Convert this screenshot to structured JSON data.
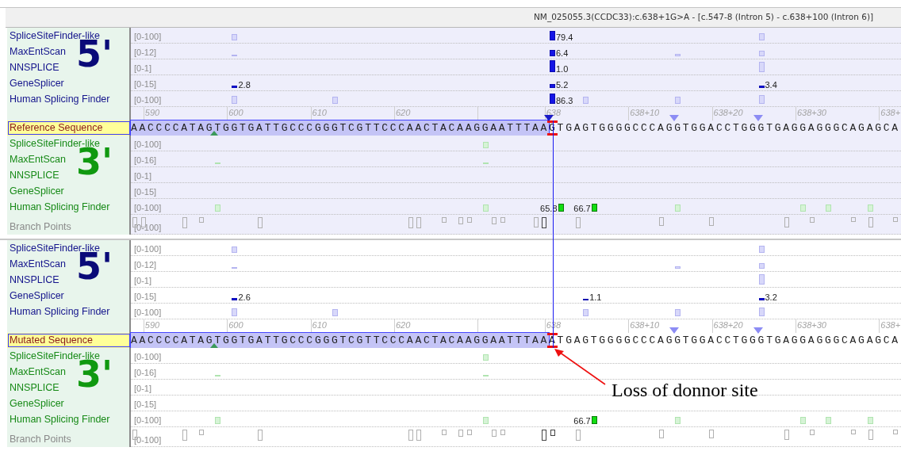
{
  "header": {
    "title": "NM_025055.3(CCDC33):c.638+1G>A - [c.547-8 (Intron 5) - c.638+100 (Intron 6)]"
  },
  "blocks": [
    {
      "kind": "donor_tracks",
      "site": "5'",
      "shaded": true,
      "tracks": [
        {
          "kind": "score",
          "name": "SpliceSiteFinder-like",
          "range": "[0-100]",
          "bars": [
            {
              "highlighted": false
            },
            {
              "highlighted": true,
              "value": "79.4"
            },
            {
              "highlighted": false
            }
          ]
        },
        {
          "kind": "score",
          "name": "MaxEntScan",
          "range": "[0-12]",
          "bars": [
            {
              "highlighted": false
            },
            {
              "highlighted": true,
              "value": "6.4"
            },
            {
              "highlighted": false
            },
            {
              "highlighted": false
            }
          ]
        },
        {
          "kind": "score",
          "name": "NNSPLICE",
          "range": "[0-1]",
          "bars": [
            {
              "highlighted": true,
              "value": "1.0"
            },
            {
              "highlighted": false
            }
          ]
        },
        {
          "kind": "score",
          "name": "GeneSplicer",
          "range": "[0-15]",
          "bars": [
            {
              "highlighted": true,
              "value": "2.8"
            },
            {
              "highlighted": true,
              "value": "5.2"
            },
            {
              "highlighted": true,
              "value": "3.4"
            }
          ]
        },
        {
          "kind": "score",
          "name": "Human Splicing Finder",
          "range": "[0-100]",
          "bars": [
            {
              "highlighted": false
            },
            {
              "highlighted": false
            },
            {
              "highlighted": true,
              "value": "86.3"
            },
            {
              "highlighted": false
            },
            {
              "highlighted": false
            },
            {
              "highlighted": false
            }
          ]
        }
      ]
    },
    {
      "kind": "sequence",
      "shaded": true,
      "ruler": [
        "590",
        "600",
        "610",
        "620",
        "638",
        "638+10",
        "638+20",
        "638+30",
        "638+"
      ],
      "ruler_markers": [
        {
          "kind": "strong"
        },
        {
          "kind": "weak"
        },
        {
          "kind": "weak"
        }
      ],
      "label": "Reference Sequence",
      "exon": "AACCCCATAGTGGTGATTGCCCGGGTCGTTCCCAACTACAAGGAATTTAA",
      "intron": "GTGAGTGGGGCCCAGGTGGACCTGGGTGAGGAGGGCAGAGCA",
      "markers": [
        {
          "kind": "acceptor"
        },
        {
          "kind": "variant"
        }
      ]
    },
    {
      "kind": "acceptor_tracks",
      "site": "3'",
      "shaded": true,
      "tracks": [
        {
          "kind": "score",
          "name": "SpliceSiteFinder-like",
          "range": "[0-100]",
          "bars": [
            {
              "highlighted": false
            }
          ]
        },
        {
          "kind": "score",
          "name": "MaxEntScan",
          "range": "[0-16]",
          "bars": [
            {
              "highlighted": false
            },
            {
              "highlighted": false
            }
          ]
        },
        {
          "kind": "score",
          "name": "NNSPLICE",
          "range": "[0-1]"
        },
        {
          "kind": "score",
          "name": "GeneSplicer",
          "range": "[0-15]"
        },
        {
          "kind": "score",
          "name": "Human Splicing Finder",
          "range": "[0-100]",
          "bars": [
            {
              "highlighted": false
            },
            {
              "highlighted": false
            },
            {
              "highlighted": true,
              "value": "65.8"
            },
            {
              "highlighted": true,
              "value": "66.7"
            },
            {
              "highlighted": false
            },
            {
              "highlighted": false
            },
            {
              "highlighted": false
            },
            {
              "highlighted": false
            }
          ]
        },
        {
          "kind": "branch",
          "name": "Branch Points",
          "range": "[0-100]",
          "points": [
            {
              "highlighted": false
            },
            {
              "highlighted": false
            },
            {
              "highlighted": false
            },
            {
              "highlighted": false
            },
            {
              "highlighted": false
            },
            {
              "highlighted": false
            },
            {
              "highlighted": false
            },
            {
              "highlighted": false
            },
            {
              "highlighted": false
            },
            {
              "highlighted": false
            },
            {
              "highlighted": false
            },
            {
              "highlighted": false
            },
            {
              "highlighted": false
            },
            {
              "highlighted": true
            },
            {
              "highlighted": false
            },
            {
              "highlighted": false
            },
            {
              "highlighted": false
            },
            {
              "highlighted": false
            },
            {
              "highlighted": false
            },
            {
              "highlighted": false
            },
            {
              "highlighted": false
            },
            {
              "highlighted": false
            }
          ]
        }
      ]
    },
    {
      "kind": "donor_tracks",
      "site": "5'",
      "shaded": false,
      "tracks": [
        {
          "kind": "score",
          "name": "SpliceSiteFinder-like",
          "range": "[0-100]",
          "bars": [
            {
              "highlighted": false
            },
            {
              "highlighted": false
            }
          ]
        },
        {
          "kind": "score",
          "name": "MaxEntScan",
          "range": "[0-12]",
          "bars": [
            {
              "highlighted": false
            },
            {
              "highlighted": false
            },
            {
              "highlighted": false
            }
          ]
        },
        {
          "kind": "score",
          "name": "NNSPLICE",
          "range": "[0-1]",
          "bars": [
            {
              "highlighted": false
            }
          ]
        },
        {
          "kind": "score",
          "name": "GeneSplicer",
          "range": "[0-15]",
          "bars": [
            {
              "highlighted": true,
              "value": "2.6"
            },
            {
              "highlighted": true,
              "value": "1.1"
            },
            {
              "highlighted": true,
              "value": "3.2"
            }
          ]
        },
        {
          "kind": "score",
          "name": "Human Splicing Finder",
          "range": "[0-100]",
          "bars": [
            {
              "highlighted": false
            },
            {
              "highlighted": false
            },
            {
              "highlighted": false
            },
            {
              "highlighted": false
            },
            {
              "highlighted": false
            }
          ]
        }
      ]
    },
    {
      "kind": "sequence",
      "shaded": false,
      "ruler": [
        "590",
        "600",
        "610",
        "620",
        "638",
        "638+10",
        "638+20",
        "638+30",
        "638+"
      ],
      "ruler_markers": [
        {
          "kind": "weak"
        },
        {
          "kind": "weak"
        }
      ],
      "label": "Mutated Sequence",
      "exon": "AACCCCATAGTGGTGATTGCCCGGGTCGTTCCCAACTACAAGGAATTTAA",
      "intron": "ATGAGTGGGGCCCAGGTGGACCTGGGTGAGGAGGGCAGAGCA",
      "markers": [
        {
          "kind": "acceptor"
        },
        {
          "kind": "variant"
        }
      ]
    },
    {
      "kind": "acceptor_tracks",
      "site": "3'",
      "shaded": false,
      "tracks": [
        {
          "kind": "score",
          "name": "SpliceSiteFinder-like",
          "range": "[0-100]",
          "bars": [
            {
              "highlighted": false
            }
          ]
        },
        {
          "kind": "score",
          "name": "MaxEntScan",
          "range": "[0-16]",
          "bars": [
            {
              "highlighted": false
            },
            {
              "highlighted": false
            }
          ]
        },
        {
          "kind": "score",
          "name": "NNSPLICE",
          "range": "[0-1]"
        },
        {
          "kind": "score",
          "name": "GeneSplicer",
          "range": "[0-15]"
        },
        {
          "kind": "score",
          "name": "Human Splicing Finder",
          "range": "[0-100]",
          "bars": [
            {
              "highlighted": false
            },
            {
              "highlighted": false
            },
            {
              "highlighted": true,
              "value": "66.7"
            },
            {
              "highlighted": false
            },
            {
              "highlighted": false
            },
            {
              "highlighted": false
            },
            {
              "highlighted": false
            }
          ]
        },
        {
          "kind": "branch",
          "name": "Branch Points",
          "range": "[0-100]",
          "points": [
            {
              "highlighted": false
            },
            {
              "highlighted": false
            },
            {
              "highlighted": false
            },
            {
              "highlighted": false
            },
            {
              "highlighted": false
            },
            {
              "highlighted": false
            },
            {
              "highlighted": false
            },
            {
              "highlighted": false
            },
            {
              "highlighted": false
            },
            {
              "highlighted": false
            },
            {
              "highlighted": false
            },
            {
              "highlighted": true
            },
            {
              "highlighted": true
            },
            {
              "highlighted": false
            },
            {
              "highlighted": false
            },
            {
              "highlighted": false
            },
            {
              "highlighted": false
            },
            {
              "highlighted": false
            },
            {
              "highlighted": false
            },
            {
              "highlighted": false
            },
            {
              "highlighted": false
            }
          ]
        }
      ]
    }
  ],
  "callout": {
    "text": "Loss of donnor site"
  }
}
